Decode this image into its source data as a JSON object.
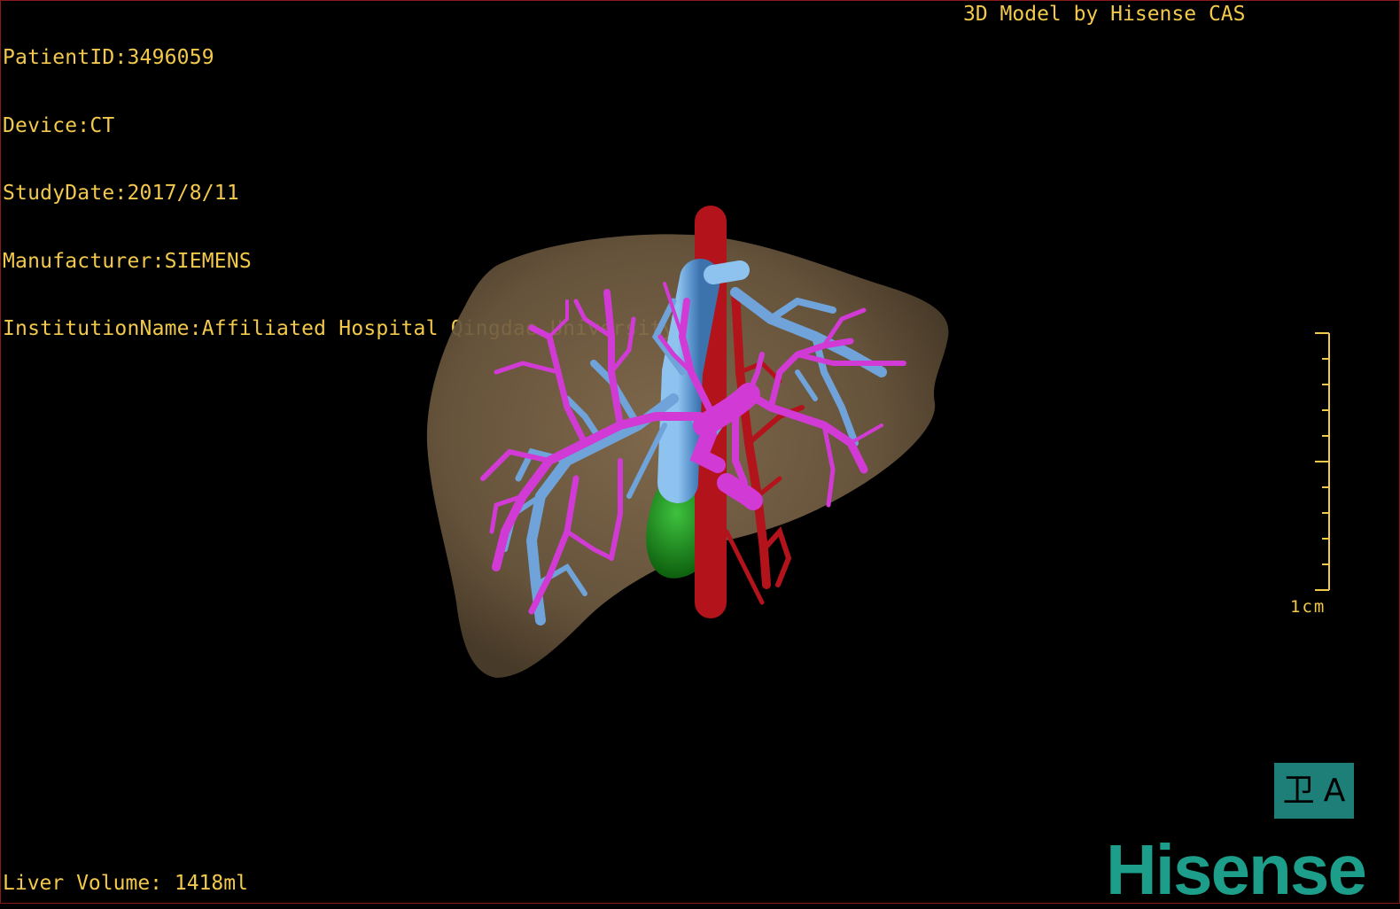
{
  "patient": {
    "patient_id": "PatientID:3496059",
    "device": "Device:CT",
    "study_date": "StudyDate:2017/8/11",
    "manufacturer": "Manufacturer:SIEMENS",
    "institution": "InstitutionName:Affiliated Hospital Qingdao University-C"
  },
  "credit": "3D Model by Hisense CAS",
  "liver_volume": "Liver Volume: 1418ml",
  "scale_bar": {
    "label": "1cm"
  },
  "orientation": {
    "left_glyph": "卫",
    "right_glyph": "A"
  },
  "brand": "Hisense",
  "colors": {
    "text": "#f2c94c",
    "liver": "#7a6448",
    "portal_vein": "#d23ad6",
    "hepatic_vein": "#6fa3d9",
    "artery_ivc": "#b3131a",
    "gallbladder": "#1f8f1f",
    "orient_badge": "#1e7f78",
    "brand": "#1d9e8a"
  }
}
